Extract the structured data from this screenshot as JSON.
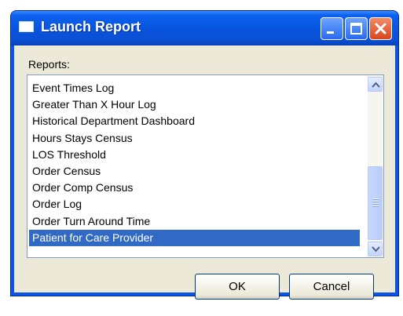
{
  "window": {
    "title": "Launch Report",
    "buttons": {
      "minimize_icon": "minimize-icon",
      "maximize_icon": "maximize-icon",
      "close_icon": "close-icon"
    }
  },
  "reports": {
    "label": "Reports:",
    "items": [
      "Event Times Log",
      "Greater Than X Hour Log",
      "Historical Department Dashboard",
      "Hours Stays Census",
      "LOS Threshold",
      "Order Census",
      "Order Comp Census",
      "Order Log",
      "Order Turn Around Time",
      "Patient for Care Provider"
    ],
    "selected": "Patient for Care Provider"
  },
  "actions": {
    "ok_label": "OK",
    "cancel_label": "Cancel"
  },
  "colors": {
    "titlebar": "#0a54e6",
    "selection": "#316ac5",
    "dialog_bg": "#ece9d8"
  }
}
